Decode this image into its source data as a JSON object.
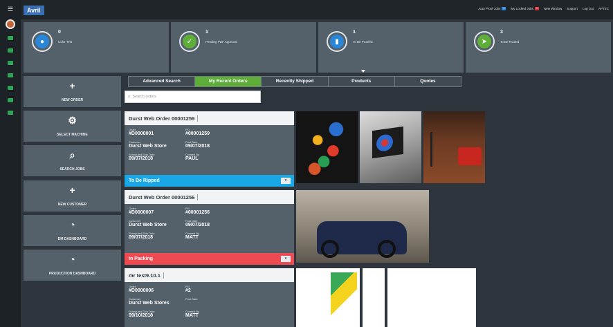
{
  "app": {
    "brand": "Avril"
  },
  "topbar": {
    "links": [
      {
        "label": "Auto Proof Jobs",
        "badge": "0",
        "badge_color": "blue",
        "icon": "refresh-icon"
      },
      {
        "label": "My Locked Jobs",
        "badge": "0",
        "badge_color": "red",
        "icon": "lock-icon"
      },
      {
        "label": "New Window",
        "icon": "window-icon"
      },
      {
        "label": "Support",
        "icon": "support-icon"
      },
      {
        "label": "Log Out",
        "icon": "logout-icon"
      },
      {
        "label": "APTEC",
        "icon": "user-icon"
      }
    ]
  },
  "stats": [
    {
      "count": "0",
      "label": "Color Test",
      "icon": "droplet-icon",
      "color": "#2a87d8"
    },
    {
      "count": "1",
      "label": "Pending PDF Approval",
      "icon": "check-icon",
      "color": "#5fae3a"
    },
    {
      "count": "1",
      "label": "To Be Proofed",
      "icon": "document-icon",
      "color": "#2a87d8"
    },
    {
      "count": "3",
      "label": "To Be Routed",
      "icon": "send-icon",
      "color": "#5fae3a"
    }
  ],
  "sidebar": [
    {
      "label": "NEW ORDER",
      "icon": "plus-icon"
    },
    {
      "label": "SELECT MACHINE",
      "icon": "gears-icon"
    },
    {
      "label": "SEARCH JOBS",
      "icon": "search-icon"
    },
    {
      "label": "NEW CUSTOMER",
      "icon": "plus-icon"
    },
    {
      "label": "DM DASHBOARD",
      "icon": "gauge-icon"
    },
    {
      "label": "PRODUCTION DASHBOARD",
      "icon": "gauge-icon"
    }
  ],
  "tabs": [
    "Advanced Search",
    "My Recent Orders",
    "Recently Shipped",
    "Products",
    "Quotes"
  ],
  "active_tab": "My Recent Orders",
  "search": {
    "placeholder": "Search orders"
  },
  "labels": {
    "order": "Order",
    "po": "PO",
    "customer": "Customer",
    "post_date": "Post Date",
    "ship_date": "Scheduled Ship Date",
    "created_by": "Created By"
  },
  "orders": [
    {
      "title": "Durst Web Order 00001259",
      "order": "#D0000001",
      "po": "#00001259",
      "customer": "Durst Web Store",
      "post_date": "09/07/2018",
      "ship_date": "09/07/2018",
      "created_by": "PAUL",
      "status": "To Be Ripped",
      "status_color": "#1aa7e6"
    },
    {
      "title": "Durst Web Order 00001256",
      "order": "#D0000007",
      "po": "#00001256",
      "customer": "Durst Web Store",
      "post_date": "09/07/2018",
      "ship_date": "09/07/2018",
      "created_by": "MATT",
      "status": "In Packing",
      "status_color": "#ee4a52"
    },
    {
      "title": "mr test9.10.1",
      "order": "#D0000006",
      "po": "#2",
      "customer": "Durst Web Stores",
      "post_date": "",
      "ship_date": "09/10/2018",
      "created_by": "MATT"
    }
  ],
  "icons": {
    "menu": "☰",
    "dropdown": "▾"
  }
}
